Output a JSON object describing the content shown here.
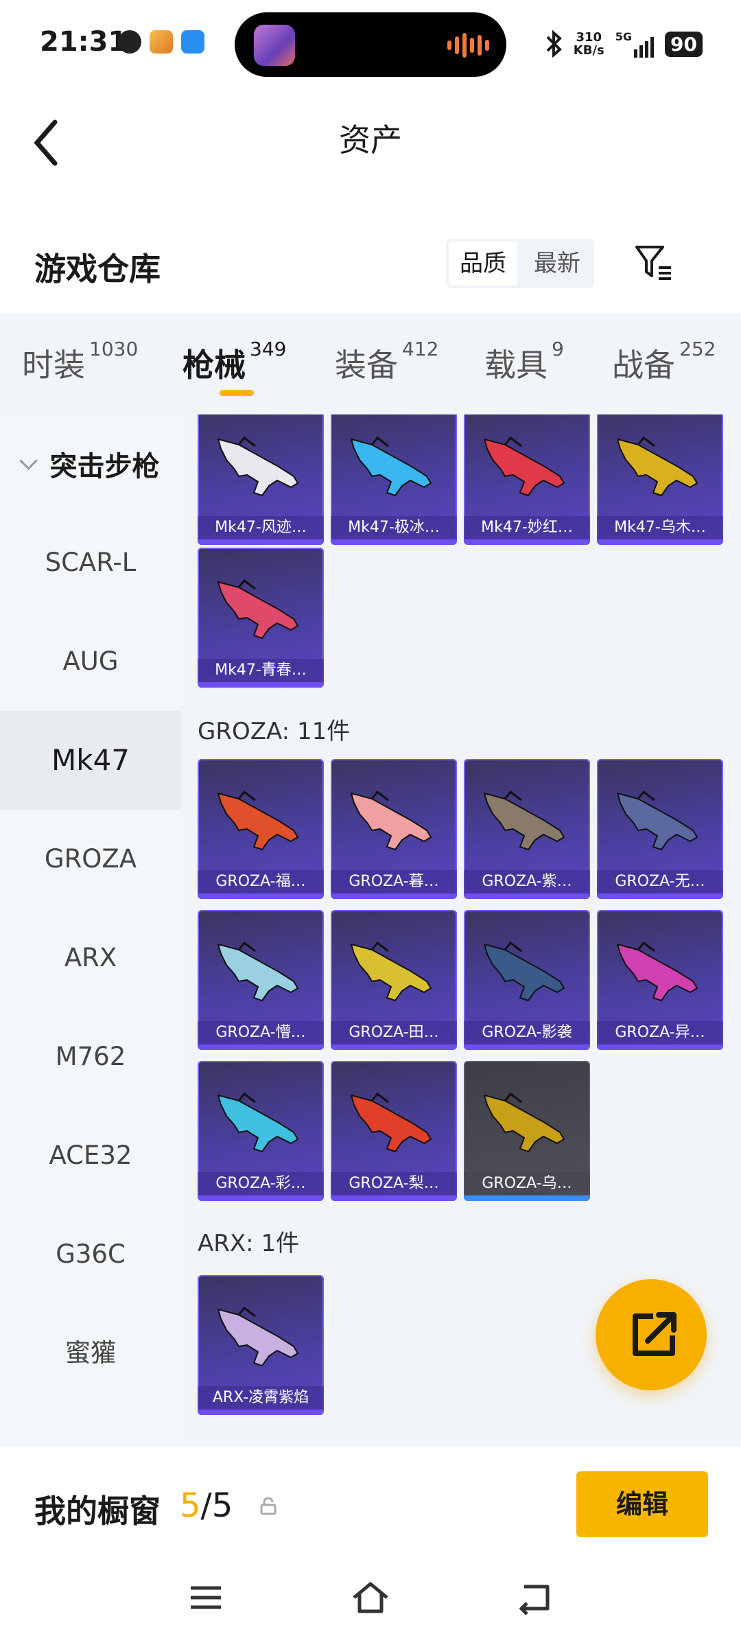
{
  "status": {
    "time": "21:31",
    "net_speed_value": "310",
    "net_speed_unit": "KB/s",
    "signal_label": "5G",
    "battery": "90"
  },
  "header": {
    "title": "资产",
    "back_icon": "chevron-left-icon"
  },
  "warehouse": {
    "title": "游戏仓库",
    "sort_options": [
      "品质",
      "最新"
    ],
    "sort_selected": "品质",
    "filter_icon": "filter-icon"
  },
  "tabs": [
    {
      "label": "时装",
      "count": "1030"
    },
    {
      "label": "枪械",
      "count": "349",
      "active": true
    },
    {
      "label": "装备",
      "count": "412"
    },
    {
      "label": "载具",
      "count": "9"
    },
    {
      "label": "战备",
      "count": "252"
    }
  ],
  "sidebar": {
    "category": "突击步枪",
    "items": [
      "SCAR-L",
      "AUG",
      "Mk47",
      "GROZA",
      "ARX",
      "M762",
      "ACE32",
      "G36C",
      "蜜獾"
    ],
    "selected": "Mk47"
  },
  "sections": {
    "mk47": {
      "items": [
        "Mk47-风迹…",
        "Mk47-极冰…",
        "Mk47-妙红…",
        "Mk47-乌木…",
        "Mk47-青春…"
      ]
    },
    "groza": {
      "header": "GROZA: 11件",
      "items": [
        "GROZA-福…",
        "GROZA-暮…",
        "GROZA-紫…",
        "GROZA-无…",
        "GROZA-懵…",
        "GROZA-田…",
        "GROZA-影袭",
        "GROZA-异…",
        "GROZA-彩…",
        "GROZA-梨…",
        "GROZA-乌…"
      ]
    },
    "arx": {
      "header": "ARX: 1件",
      "items": [
        "ARX-凌霄紫焰"
      ]
    }
  },
  "fab": {
    "icon": "share-edit-icon"
  },
  "showcase": {
    "label": "我的橱窗",
    "count_current": "5",
    "count_total": "/5",
    "edit_label": "编辑"
  },
  "colors": {
    "accent": "#f8b600",
    "card_purple": "#4b3fa0",
    "tab_bg": "#f1f4f8"
  }
}
